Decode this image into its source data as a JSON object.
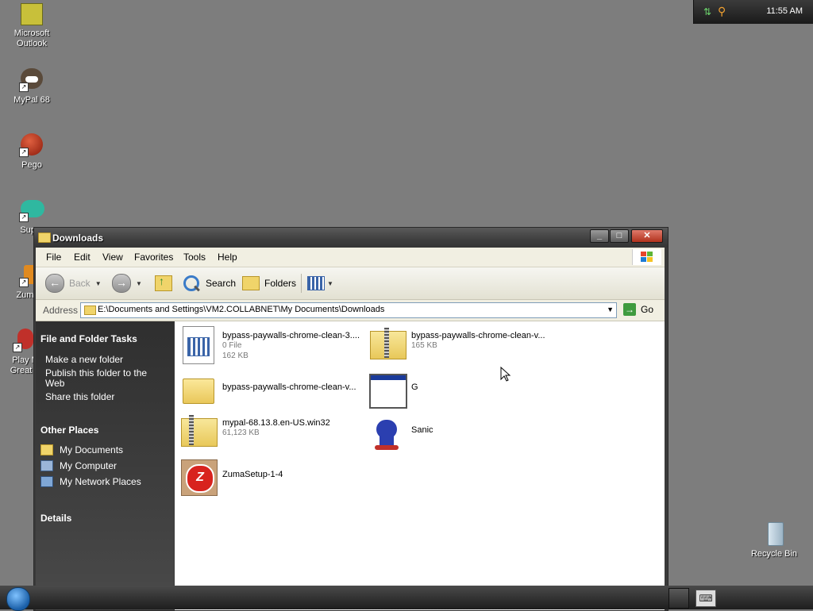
{
  "desktop": {
    "icons": [
      {
        "label": "Microsoft Outlook",
        "icon": "outlook-icon"
      },
      {
        "label": "MyPal 68",
        "icon": "mypal-icon"
      },
      {
        "label": "Pego",
        "icon": "pego-icon"
      },
      {
        "label": "Super",
        "icon": "super-icon"
      },
      {
        "label": "Zuma D",
        "icon": "zuma-icon"
      },
      {
        "label": "Play M Great C",
        "icon": "play-icon"
      },
      {
        "label": "Recycle Bin",
        "icon": "recycle-bin-icon"
      }
    ]
  },
  "window": {
    "title": "Downloads",
    "controls": {
      "minimize": "_",
      "maximize": "□",
      "close": "✕"
    },
    "menu": [
      "File",
      "Edit",
      "View",
      "Favorites",
      "Tools",
      "Help"
    ],
    "toolbar": {
      "back": "Back",
      "search": "Search",
      "folders": "Folders"
    },
    "address": {
      "label": "Address",
      "value": "E:\\Documents and Settings\\VM2.COLLABNET\\My Documents\\Downloads",
      "go": "Go"
    },
    "taskpane": {
      "file_tasks_title": "File and Folder Tasks",
      "file_tasks": [
        "Make a new folder",
        "Publish this folder to the Web",
        "Share this folder"
      ],
      "other_places_title": "Other Places",
      "other_places": [
        "My Documents",
        "My Computer",
        "My Network Places"
      ],
      "details_title": "Details"
    },
    "files": [
      {
        "name": "bypass-paywalls-chrome-clean-3....",
        "meta1": "0 File",
        "meta2": "162 KB",
        "kind": "document"
      },
      {
        "name": "bypass-paywalls-chrome-clean-v...",
        "meta1": "165 KB",
        "meta2": "",
        "kind": "zip"
      },
      {
        "name": "bypass-paywalls-chrome-clean-v...",
        "meta1": "",
        "meta2": "",
        "kind": "folder"
      },
      {
        "name": "G",
        "meta1": "",
        "meta2": "",
        "kind": "window"
      },
      {
        "name": "mypal-68.13.8.en-US.win32",
        "meta1": "61,123 KB",
        "meta2": "",
        "kind": "zip"
      },
      {
        "name": "Sanic",
        "meta1": "",
        "meta2": "",
        "kind": "sanic"
      },
      {
        "name": "ZumaSetup-1-4",
        "meta1": "",
        "meta2": "",
        "kind": "zuma"
      }
    ]
  },
  "taskbar": {
    "clock": "11:55 AM"
  }
}
